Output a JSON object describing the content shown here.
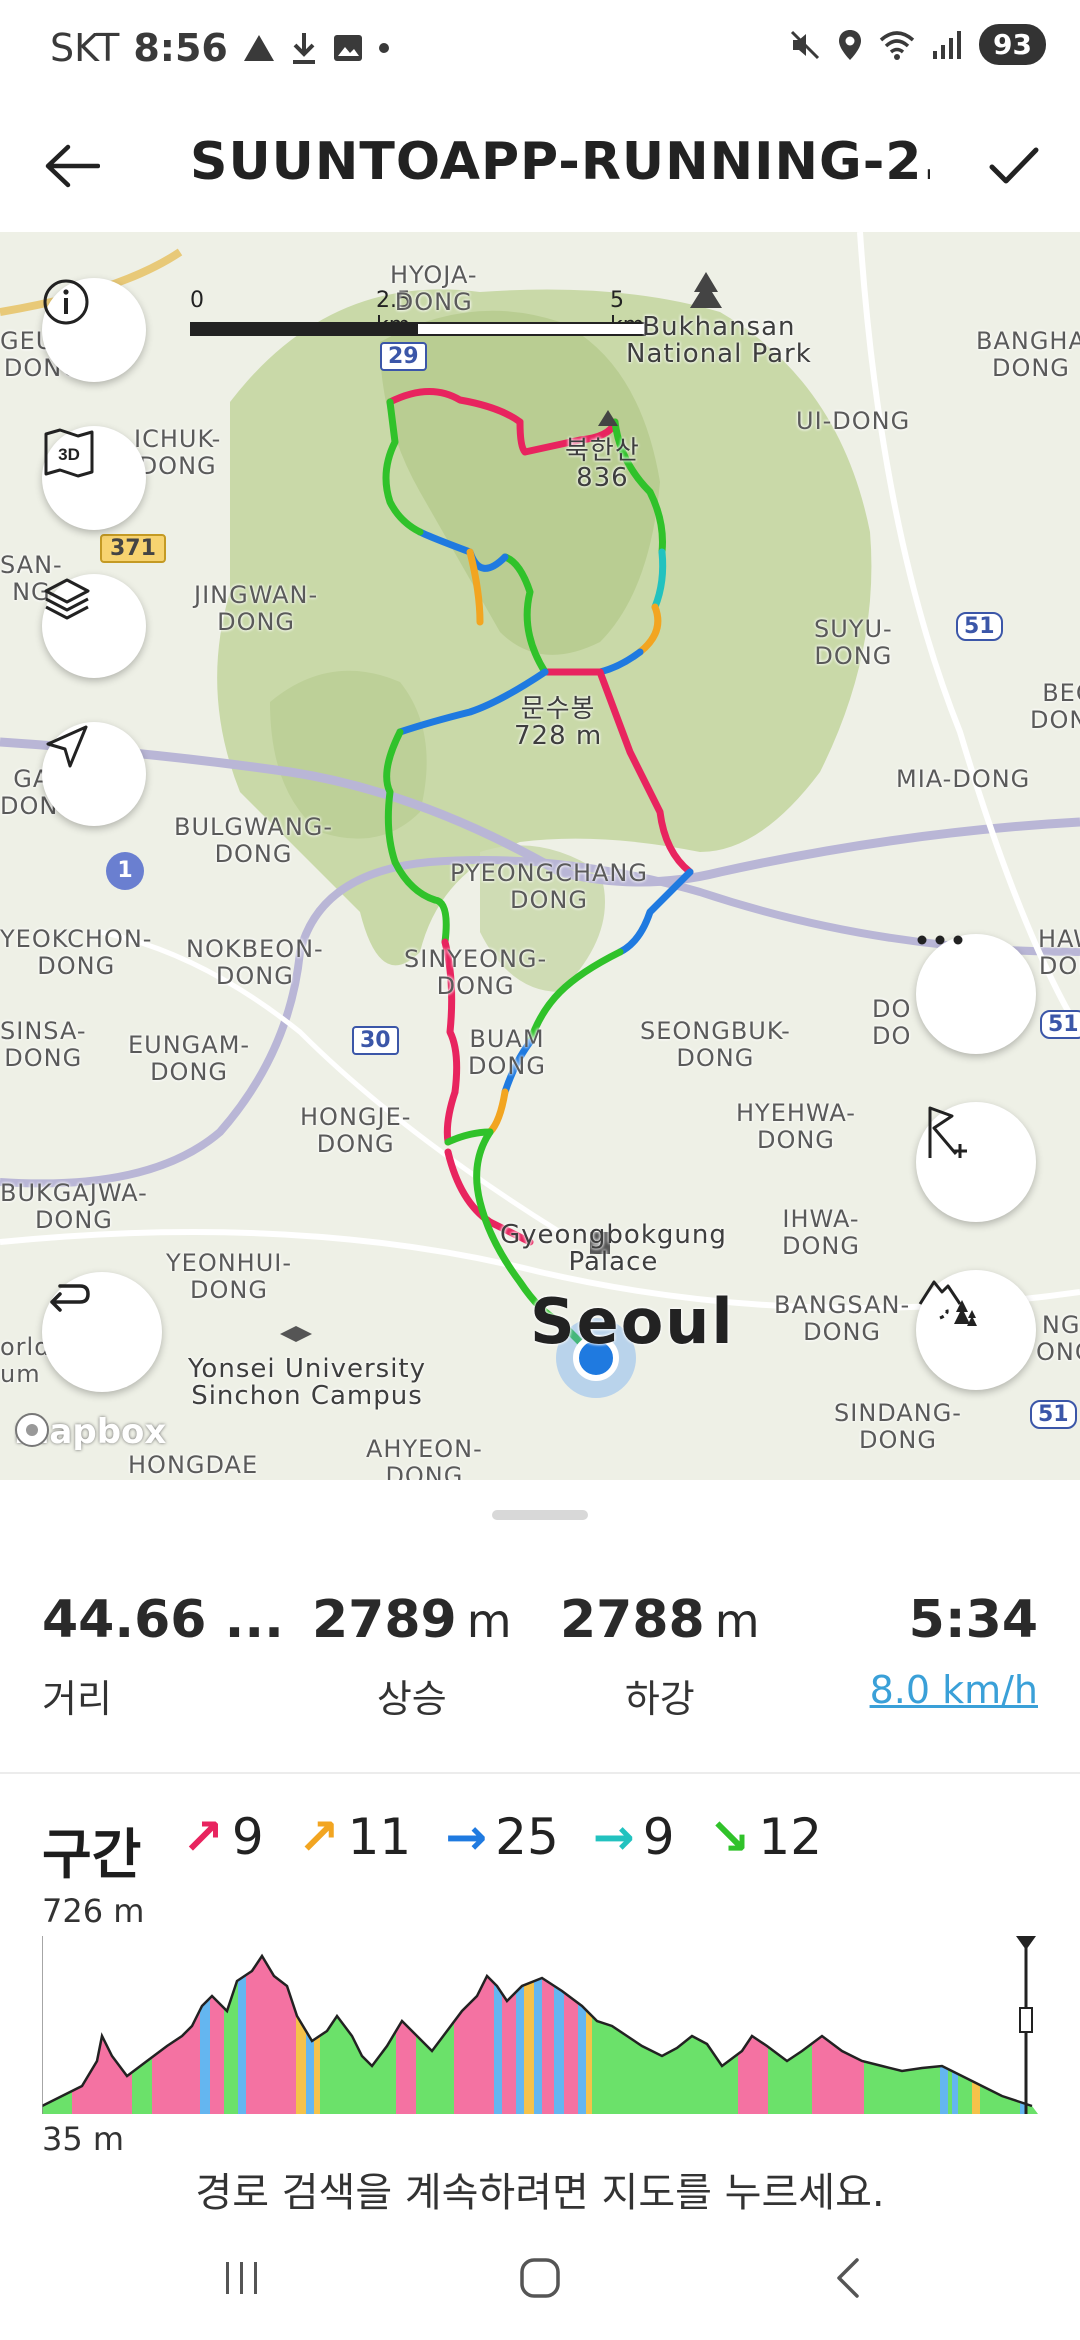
{
  "status_bar": {
    "carrier": "SKT",
    "time": "8:56",
    "battery": "93"
  },
  "header": {
    "title": "SUUNTOAPP-RUNNING-2..."
  },
  "map": {
    "scale": {
      "zero": "0",
      "mid": "2.5 km",
      "max": "5 km"
    },
    "labels": {
      "hyoja": "HYOJA-\nDONG",
      "bukhansan_np": "Bukhansan\nNational Park",
      "bangha": "BANGHA\nDONG",
      "geum": "GEUM-\nDONG",
      "bukhansan_peak": "북한산\n836",
      "ichuk": "ICHUK-\nDONG",
      "uidong": "UI-DONG",
      "san": "SAN-\nNG",
      "jingwan": "JINGWAN-\nDONG",
      "suyu": "SUYU-\nDONG",
      "beo": "BEO\nDONG",
      "munsubong": "문수봉\n728 m",
      "gal": "GAL\nDONG",
      "mia": "MIA-DONG",
      "bulgwang": "BULGWANG-\nDONG",
      "pyeongchang": "PYEONGCHANG\nDONG",
      "yeokchon": "YEOKCHON-\nDONG",
      "nokbeon": "NOKBEON-\nDONG",
      "sinyeong": "SINYEONG-\nDONG",
      "hawo": "HAWO\nDONG",
      "sinsa": "SINSA-\nDONG",
      "eungam": "EUNGAM-\nDONG",
      "buam": "BUAM\nDONG",
      "seongbuk": "SEONGBUK-\nDONG",
      "do": "DO\nDO",
      "hongje": "HONGJE-\nDONG",
      "hyehwa": "HYEHWA-\nDONG",
      "bukgajwa": "BUKGAJWA-\nDONG",
      "gyeongbokgung": "Gyeongbokgung\nPalace",
      "ihwa": "IHWA-\nDONG",
      "yeonhui": "YEONHUI-\nDONG",
      "bangsan": "BANGSAN-\nDONG",
      "ngi": "NGI\nONG",
      "seoul": "Seoul",
      "orld": "orld\num",
      "yonsei": "Yonsei University\nSinchon Campus",
      "sindang": "SINDANG-\nDONG",
      "hongdae": "HONGDAE",
      "ahyeon": "AHYEON-\nDONG"
    },
    "road_shields": {
      "r29": "29",
      "r371": "371",
      "r51a": "51",
      "r1": "1",
      "r30": "30",
      "r51b": "51",
      "r51c": "51"
    },
    "attribution": "mapbox"
  },
  "stats": {
    "distance": {
      "value": "44.66 ...",
      "label": "거리"
    },
    "ascent": {
      "value": "2789",
      "unit": "m",
      "label": "상승"
    },
    "descent": {
      "value": "2788",
      "unit": "m",
      "label": "하강"
    },
    "pace": {
      "value": "5:34",
      "speed": "8.0 km/h"
    }
  },
  "segments": {
    "title": "구간",
    "items": [
      {
        "arrow": "↗",
        "color": "#e8245f",
        "count": "9"
      },
      {
        "arrow": "↗",
        "color": "#f2a521",
        "count": "11"
      },
      {
        "arrow": "→",
        "color": "#1f7ae0",
        "count": "25"
      },
      {
        "arrow": "→",
        "color": "#22c2bf",
        "count": "9"
      },
      {
        "arrow": "↘",
        "color": "#30c22a",
        "count": "12"
      }
    ]
  },
  "elevation": {
    "max_label": "726 m",
    "min_label": "35 m"
  },
  "hint": "경로 검색을 계속하려면 지도를 누르세요."
}
